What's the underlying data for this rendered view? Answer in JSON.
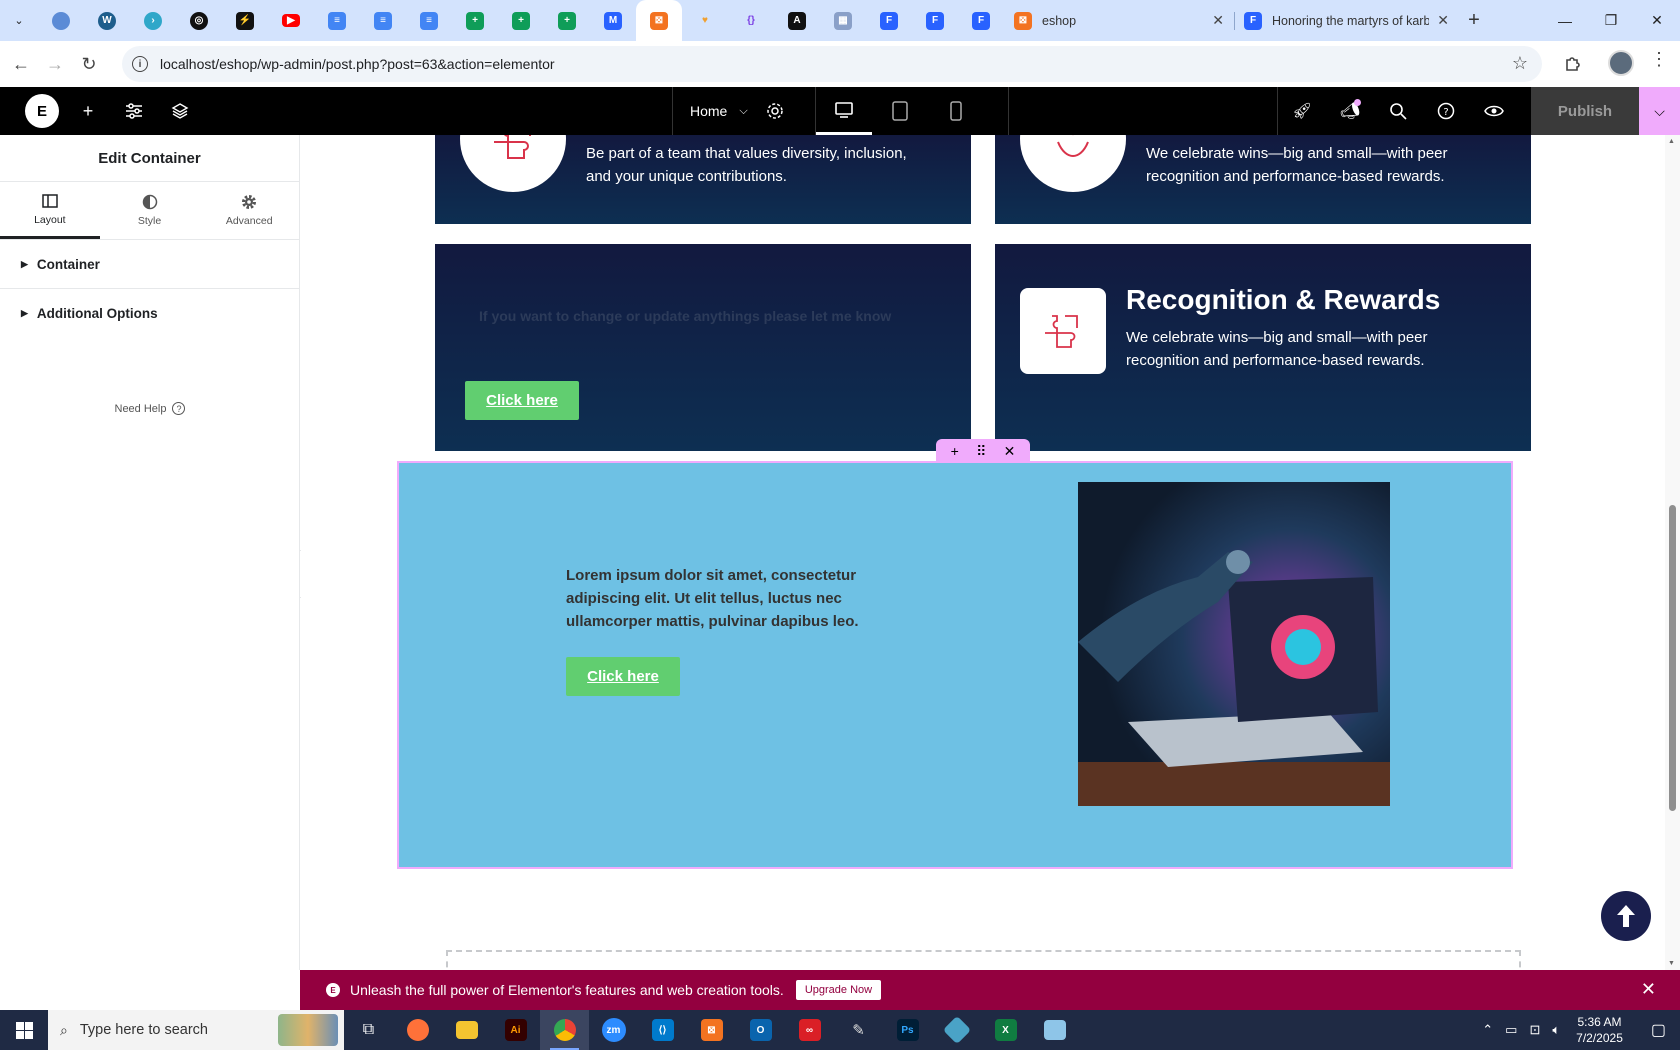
{
  "browser": {
    "tabs": [
      {
        "name": "eshop",
        "title": "eshop",
        "close": "✕"
      },
      {
        "name": "honoring",
        "title": "Honoring the martyrs of karb",
        "close": "✕"
      }
    ],
    "url": "localhost/eshop/wp-admin/post.php?post=63&action=elementor",
    "new_tab": "+",
    "controls": {
      "minimize": "—",
      "restore": "❐",
      "close": "✕"
    }
  },
  "elementor": {
    "page_selector": "Home",
    "publish_label": "Publish",
    "logo": "E"
  },
  "sidebar": {
    "title": "Edit Container",
    "tabs": [
      {
        "label": "Layout",
        "icon": "layout-icon"
      },
      {
        "label": "Style",
        "icon": "style-icon"
      },
      {
        "label": "Advanced",
        "icon": "gear-icon"
      }
    ],
    "sections": [
      "Container",
      "Additional Options"
    ],
    "need_help": "Need Help",
    "help_q": "?"
  },
  "canvas": {
    "card1_text": "Be part of a team that values diversity, inclusion, and your unique contributions.",
    "card2_text": "We celebrate wins—big and small—with peer recognition and performance-based rewards.",
    "card3_faint": "If you want to change or update anythings please let me know",
    "card3_button": "Click here",
    "card4_title": "Recognition & Rewards",
    "card4_text": "We celebrate wins—big and small—with peer recognition and performance-based rewards.",
    "section_text": "Lorem ipsum dolor sit amet, consectetur adipiscing elit. Ut elit tellus, luctus nec ullamcorper mattis, pulvinar dapibus leo.",
    "section_button": "Click here"
  },
  "promo": {
    "text": "Unleash the full power of Elementor's features and web creation tools.",
    "button": "Upgrade Now",
    "close": "✕"
  },
  "taskbar": {
    "search_placeholder": "Type here to search",
    "time": "5:36 AM",
    "date": "7/2/2025"
  },
  "colors": {
    "elementor_accent": "#f0abfc",
    "button_green": "#61ce70",
    "section_blue": "#6ec1e4",
    "promo": "#93003f",
    "card_top": "#12193f",
    "card_bottom": "#0d2f52"
  }
}
